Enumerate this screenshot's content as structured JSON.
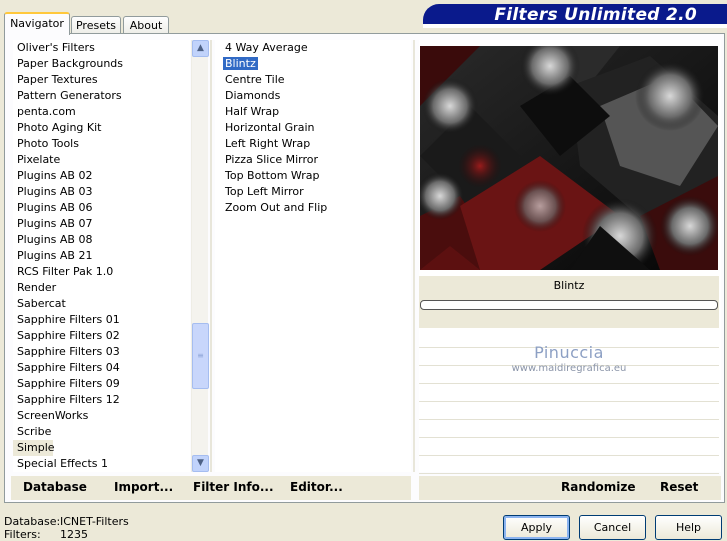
{
  "tabs": [
    {
      "label": "Navigator",
      "active": true
    },
    {
      "label": "Presets",
      "active": false
    },
    {
      "label": "About",
      "active": false
    }
  ],
  "app_title": "Filters Unlimited 2.0",
  "categories": [
    "Oliver's Filters",
    "Paper Backgrounds",
    "Paper Textures",
    "Pattern Generators",
    "penta.com",
    "Photo Aging Kit",
    "Photo Tools",
    "Pixelate",
    "Plugins AB 02",
    "Plugins AB 03",
    "Plugins AB 06",
    "Plugins AB 07",
    "Plugins AB 08",
    "Plugins AB 21",
    "RCS Filter Pak 1.0",
    "Render",
    "Sabercat",
    "Sapphire Filters 01",
    "Sapphire Filters 02",
    "Sapphire Filters 03",
    "Sapphire Filters 04",
    "Sapphire Filters 09",
    "Sapphire Filters 12",
    "ScreenWorks",
    "Scribe",
    "Simple",
    "Special Effects 1"
  ],
  "selected_category": "Simple",
  "filters": [
    "4 Way Average",
    "Blintz",
    "Centre Tile",
    "Diamonds",
    "Half Wrap",
    "Horizontal Grain",
    "Left Right Wrap",
    "Pizza Slice Mirror",
    "Top Bottom Wrap",
    "Top Left Mirror",
    "Zoom Out and Flip"
  ],
  "selected_filter": "Blintz",
  "preview": {
    "filter_name": "Blintz",
    "watermark_name": "Pinuccia",
    "watermark_url": "www.maidiregrafica.eu"
  },
  "bottom_left_buttons": {
    "database": "Database",
    "import": "Import...",
    "filter_info": "Filter Info...",
    "editor": "Editor..."
  },
  "bottom_right_buttons": {
    "randomize": "Randomize",
    "reset": "Reset"
  },
  "status": {
    "database_label": "Database:",
    "database_value": "ICNET-Filters",
    "filters_label": "Filters:",
    "filters_value": "1235"
  },
  "dialog_buttons": {
    "apply": "Apply",
    "cancel": "Cancel",
    "help": "Help"
  },
  "colors": {
    "selection": "#316ac5",
    "banner": "#0a1a8c",
    "dialog_bg": "#ece9d8"
  }
}
